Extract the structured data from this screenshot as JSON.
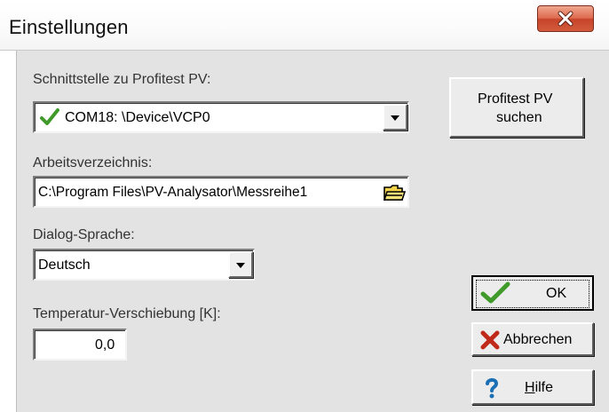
{
  "window": {
    "title": "Einstellungen",
    "close_symbol": "X"
  },
  "interface": {
    "label": "Schnittstelle zu Profitest PV:",
    "selected": "COM18: \\Device\\VCP0",
    "status_icon": "check-icon"
  },
  "search_button": {
    "line1": "Profitest PV",
    "line2": "suchen"
  },
  "workdir": {
    "label": "Arbeitsverzeichnis:",
    "value": "C:\\Program Files\\PV-Analysator\\Messreihe1",
    "browse_icon": "folder-icon"
  },
  "language": {
    "label": "Dialog-Sprache:",
    "selected": "Deutsch"
  },
  "temperature": {
    "label": "Temperatur-Verschiebung [K]:",
    "value": "0,0"
  },
  "buttons": {
    "ok": "OK",
    "cancel": "Abbrechen",
    "help_mnemonic": "H",
    "help_rest": "ilfe"
  },
  "colors": {
    "dialog_bg": "#e3e3e3",
    "ok_check": "#3f9a2a",
    "cancel_x": "#c0281a",
    "help_q": "#1b6fb5",
    "close_btn": "#d35b3c"
  }
}
